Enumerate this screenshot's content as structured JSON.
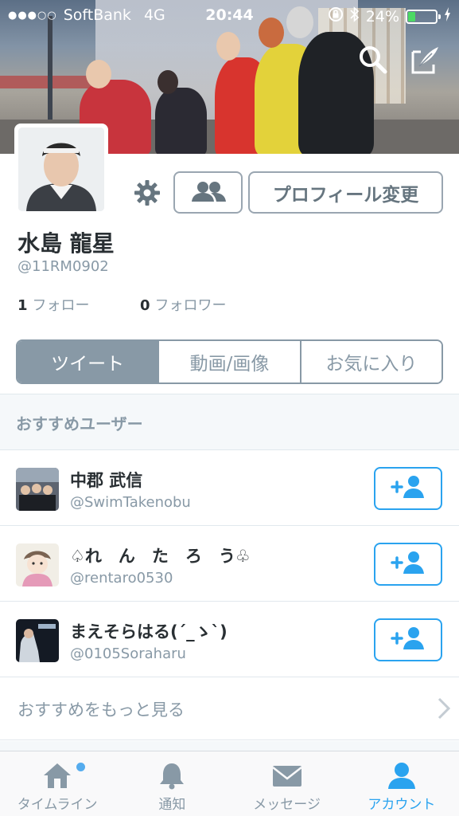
{
  "status_bar": {
    "carrier": "SoftBank",
    "signal_dots": "●●●○○",
    "network": "4G",
    "time": "20:44",
    "battery_percent": "24%",
    "battery_level": 0.24
  },
  "profile": {
    "name": "水島 龍星",
    "handle": "@11RM0902",
    "following_count": "1",
    "following_label": "フォロー",
    "followers_count": "0",
    "followers_label": "フォロワー",
    "edit_profile_label": "プロフィール変更"
  },
  "tabs": [
    {
      "label": "ツイート",
      "active": true
    },
    {
      "label": "動画/画像",
      "active": false
    },
    {
      "label": "お気に入り",
      "active": false
    }
  ],
  "recommended": {
    "header": "おすすめユーザー",
    "users": [
      {
        "name": "中郡 武信",
        "handle": "@SwimTakenobu"
      },
      {
        "name": "♤れ　ん　た　ろ　う♧",
        "handle": "@rentaro0530"
      },
      {
        "name": "まえそらはる(´_ゝ`)",
        "handle": "@0105Soraharu"
      }
    ],
    "more_label": "おすすめをもっと見る"
  },
  "tabbar": [
    {
      "label": "タイムライン",
      "icon": "home-icon",
      "active": false
    },
    {
      "label": "通知",
      "icon": "bell-icon",
      "active": false
    },
    {
      "label": "メッセージ",
      "icon": "envelope-icon",
      "active": false
    },
    {
      "label": "アカウント",
      "icon": "person-icon",
      "active": true
    }
  ],
  "colors": {
    "accent": "#2aa3ef",
    "gray": "#8899a6"
  }
}
